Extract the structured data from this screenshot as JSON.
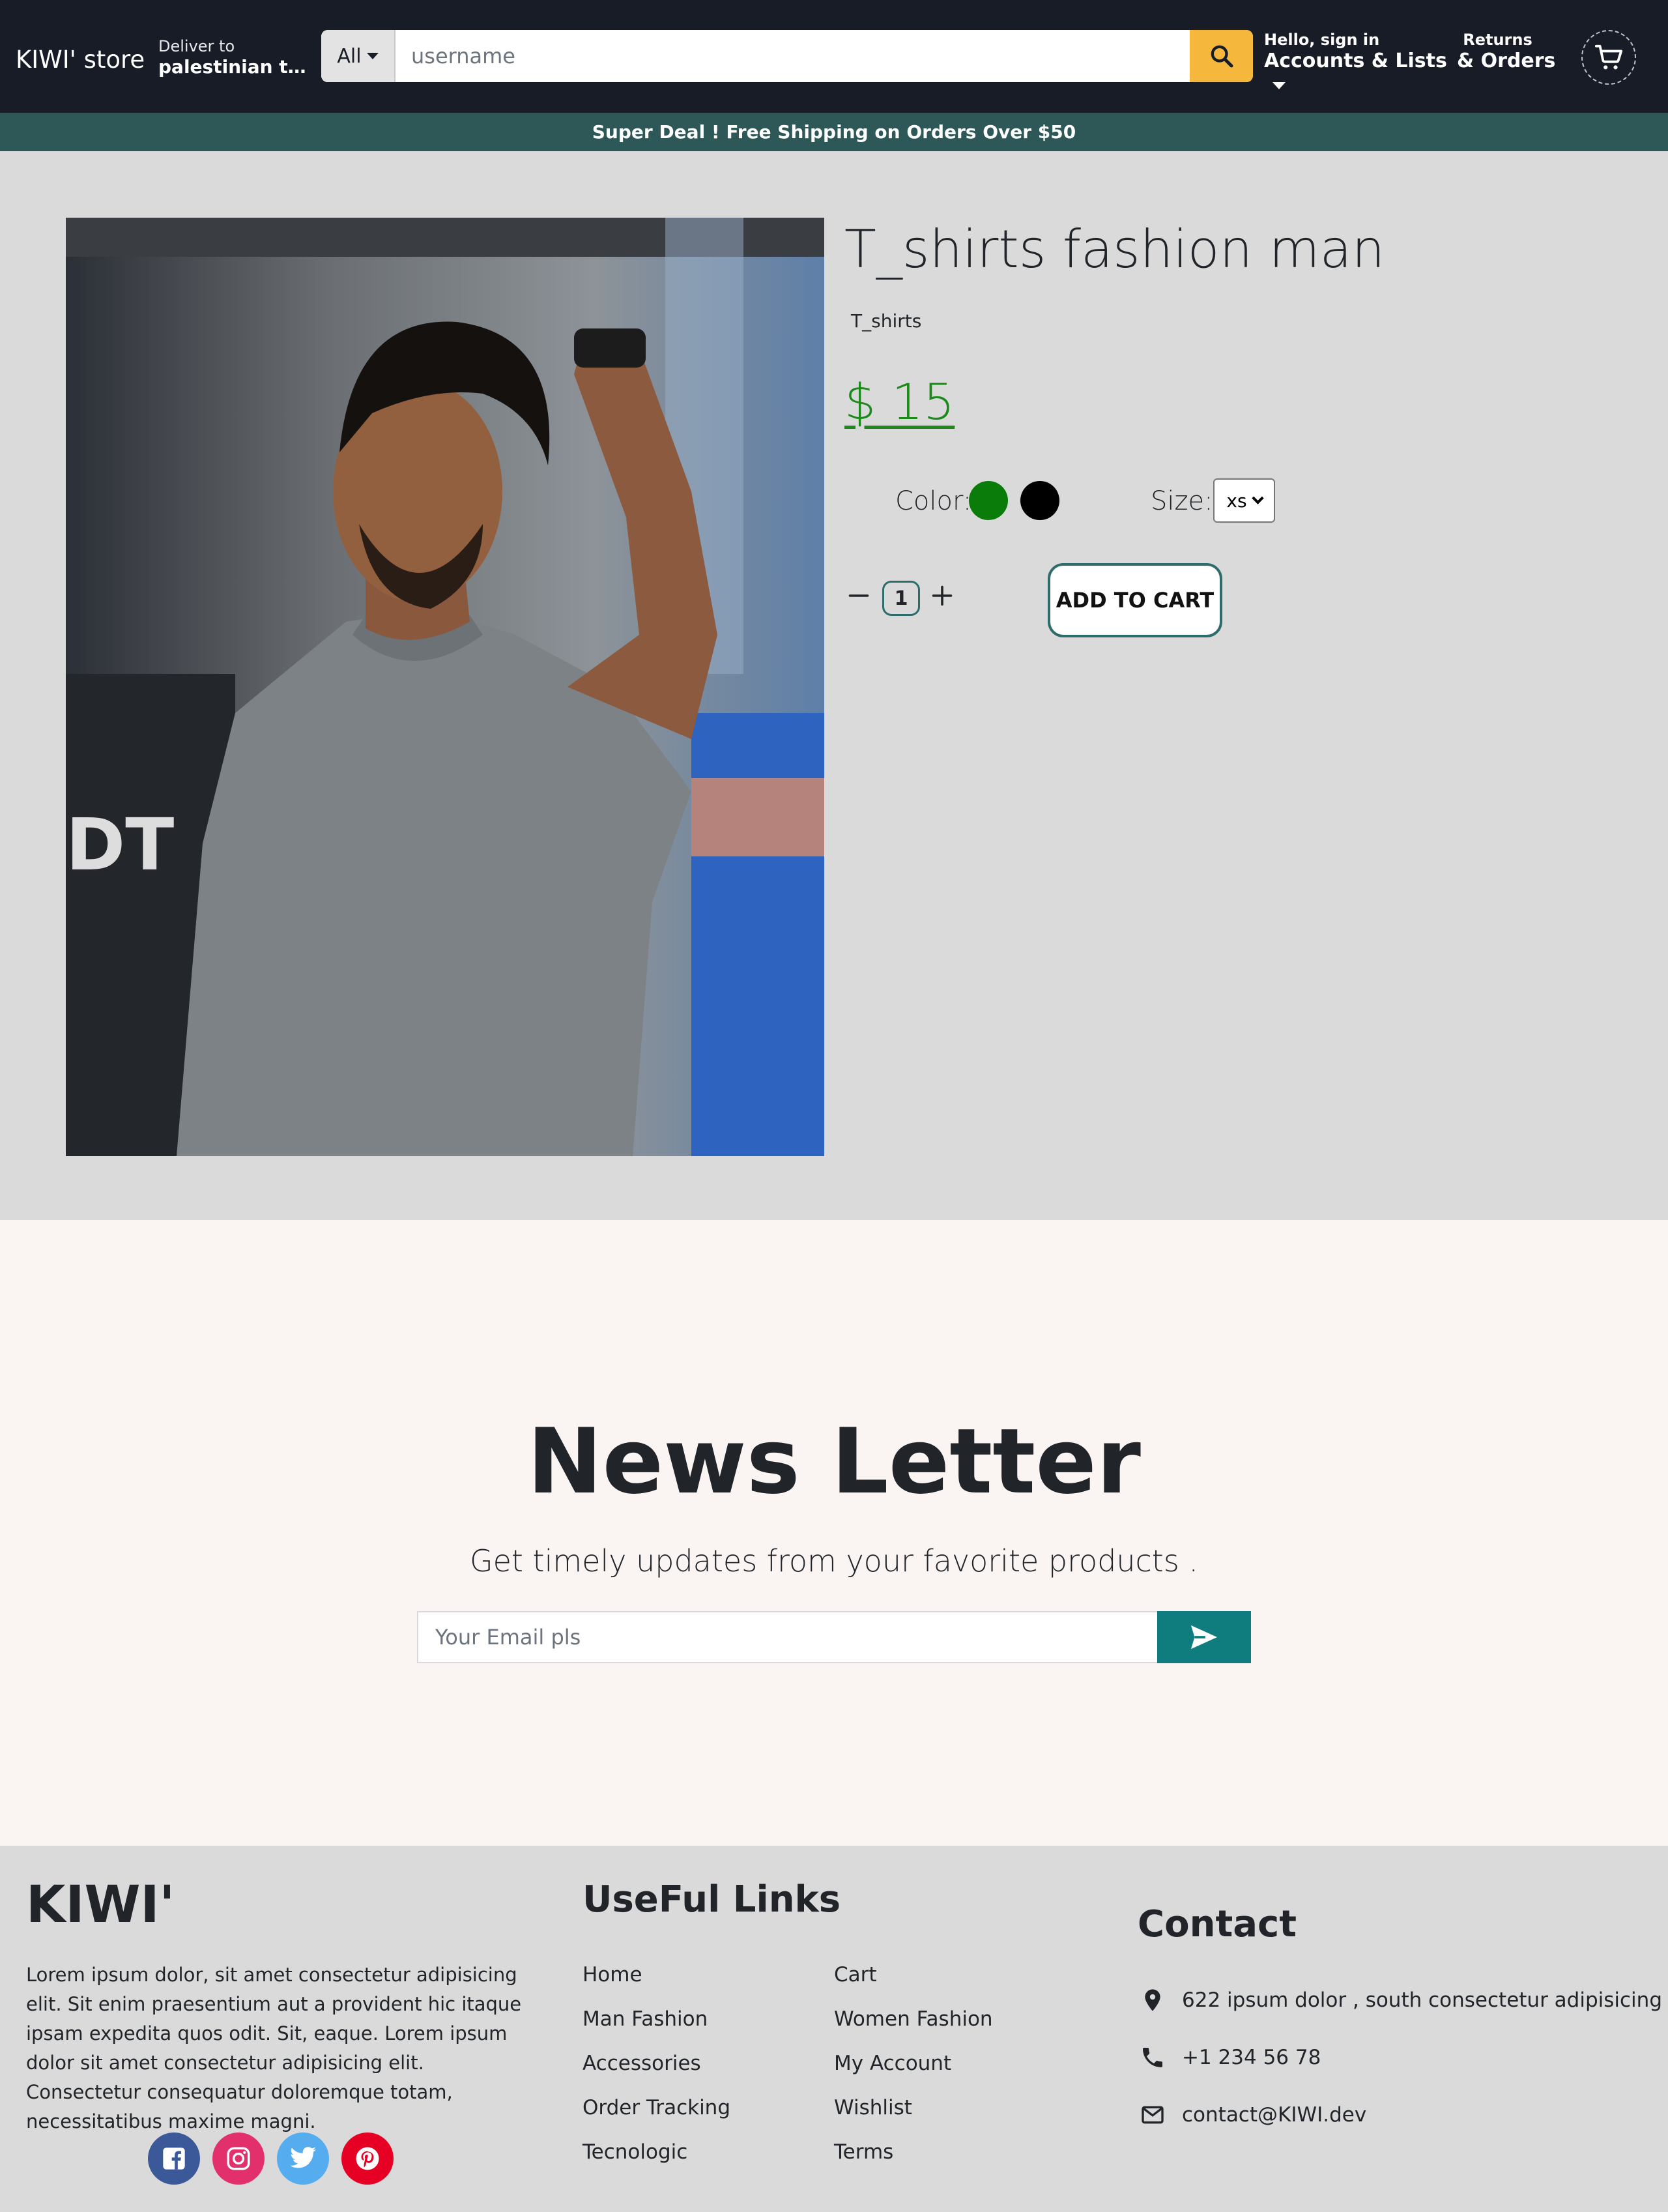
{
  "header": {
    "brand": "KIWI' store",
    "deliver_small": "Deliver to",
    "deliver_location": "palestinian terri...",
    "search_category": "All",
    "search_placeholder": "username",
    "account_small": "Hello, sign in",
    "account_big": "Accounts & Lists",
    "returns_small": "Returns",
    "returns_big": "& Orders"
  },
  "promo": "Super Deal ! Free Shipping on Orders Over $50",
  "product": {
    "title": "T_shirts fashion man",
    "category": "T_shirts",
    "price": "$ 15",
    "color_label": "Color:",
    "colors": [
      "#0a7c0a",
      "#000000"
    ],
    "size_label": "Size:",
    "size_value": "xs",
    "quantity": "1",
    "add_to_cart": "ADD TO CART"
  },
  "newsletter": {
    "title": "News Letter",
    "subtitle": "Get timely updates from your favorite products .",
    "email_placeholder": "Your Email pls"
  },
  "footer": {
    "brand": "KIWI'",
    "about": "Lorem ipsum dolor, sit amet consectetur adipisicing elit. Sit enim praesentium aut a provident hic itaque ipsam expedita quos odit. Sit, eaque. Lorem ipsum dolor sit amet consectetur adipisicing elit. Consectetur consequatur doloremque totam, necessitatibus maxime magni.",
    "links_title": "UseFul Links",
    "links_col1": [
      "Home",
      "Man Fashion",
      "Accessories",
      "Order Tracking",
      "Tecnologic"
    ],
    "links_col2": [
      "Cart",
      "Women Fashion",
      "My Account",
      "Wishlist",
      "Terms"
    ],
    "contact_title": "Contact",
    "address": "622 ipsum dolor , south consectetur adipisicing",
    "phone": "+1 234 56 78",
    "email": "contact@KIWI.dev",
    "social_colors": {
      "facebook": "#3b5998",
      "instagram": "#e1306c",
      "twitter": "#55acee",
      "pinterest": "#e60023"
    }
  }
}
